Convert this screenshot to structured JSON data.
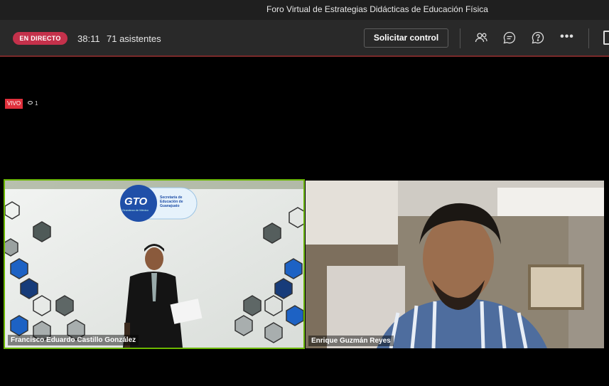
{
  "window": {
    "title": "Foro Virtual de Estrategias Didácticas de Educación Física"
  },
  "toolbar": {
    "live_label": "EN DIRECTO",
    "elapsed": "38:11",
    "attendees": "71 asistentes",
    "request_control_label": "Solicitar control",
    "icons": [
      "people-icon",
      "chat-icon",
      "qa-icon",
      "more-icon",
      "share-tray-icon"
    ],
    "live_color": "#c4314b"
  },
  "stream": {
    "live_badge": "VIVO",
    "viewer_count": "1"
  },
  "participants": [
    {
      "name": "Francisco Eduardo Castillo González",
      "active_speaker": true,
      "highlight_color": "#6bb700"
    },
    {
      "name": "Enrique Guzmán Reyes",
      "active_speaker": false
    }
  ],
  "backdrop": {
    "logo_text": "GTO",
    "logo_sub": "Grandeza de México",
    "agency_text": "Secretaría de Educación de Guanajuato"
  }
}
